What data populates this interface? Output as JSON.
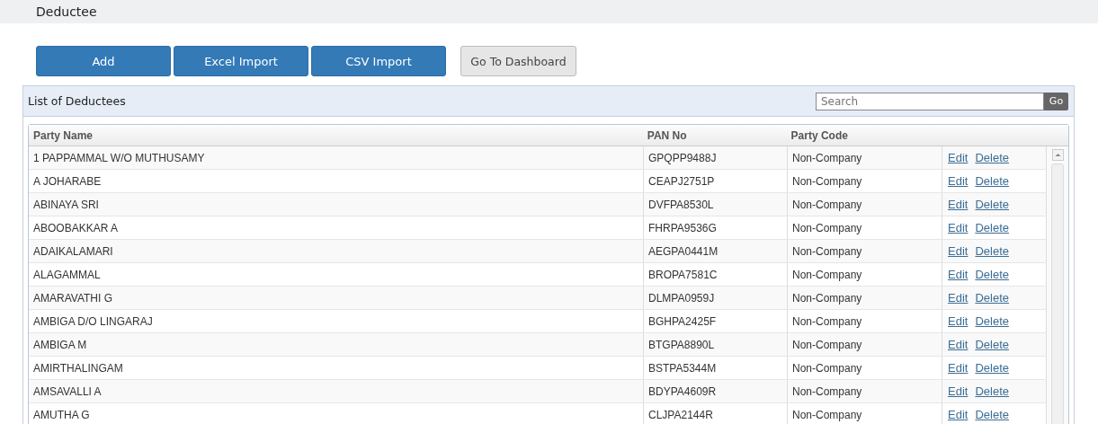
{
  "page_title": "Deductee",
  "buttons": [
    {
      "label": "Add",
      "kind": "primary"
    },
    {
      "label": "Excel Import",
      "kind": "primary"
    },
    {
      "label": "CSV Import",
      "kind": "primary"
    },
    {
      "label": "Go To Dashboard",
      "kind": "default"
    }
  ],
  "panel": {
    "title": "List of Deductees",
    "search": {
      "placeholder": "Search"
    },
    "go_button": "Go"
  },
  "table": {
    "columns": [
      "Party Name",
      "PAN No",
      "Party Code"
    ],
    "rows": [
      {
        "party_name": "1 PAPPAMMAL W/O MUTHUSAMY",
        "pan_no": "GPQPP9488J",
        "party_code": "Non-Company",
        "edit": "Edit",
        "delete": "Delete"
      },
      {
        "party_name": "A JOHARABE",
        "pan_no": "CEAPJ2751P",
        "party_code": "Non-Company",
        "edit": "Edit",
        "delete": "Delete"
      },
      {
        "party_name": "ABINAYA SRI",
        "pan_no": "DVFPA8530L",
        "party_code": "Non-Company",
        "edit": "Edit",
        "delete": "Delete"
      },
      {
        "party_name": "ABOOBAKKAR A",
        "pan_no": "FHRPA9536G",
        "party_code": "Non-Company",
        "edit": "Edit",
        "delete": "Delete"
      },
      {
        "party_name": "ADAIKALAMARI",
        "pan_no": "AEGPA0441M",
        "party_code": "Non-Company",
        "edit": "Edit",
        "delete": "Delete"
      },
      {
        "party_name": "ALAGAMMAL",
        "pan_no": "BROPA7581C",
        "party_code": "Non-Company",
        "edit": "Edit",
        "delete": "Delete"
      },
      {
        "party_name": "AMARAVATHI G",
        "pan_no": "DLMPA0959J",
        "party_code": "Non-Company",
        "edit": "Edit",
        "delete": "Delete"
      },
      {
        "party_name": "AMBIGA D/O LINGARAJ",
        "pan_no": "BGHPA2425F",
        "party_code": "Non-Company",
        "edit": "Edit",
        "delete": "Delete"
      },
      {
        "party_name": "AMBIGA M",
        "pan_no": "BTGPA8890L",
        "party_code": "Non-Company",
        "edit": "Edit",
        "delete": "Delete"
      },
      {
        "party_name": "AMIRTHALINGAM",
        "pan_no": "BSTPA5344M",
        "party_code": "Non-Company",
        "edit": "Edit",
        "delete": "Delete"
      },
      {
        "party_name": "AMSAVALLI A",
        "pan_no": "BDYPA4609R",
        "party_code": "Non-Company",
        "edit": "Edit",
        "delete": "Delete"
      },
      {
        "party_name": "AMUTHA G",
        "pan_no": "CLJPA2144R",
        "party_code": "Non-Company",
        "edit": "Edit",
        "delete": "Delete"
      }
    ]
  }
}
